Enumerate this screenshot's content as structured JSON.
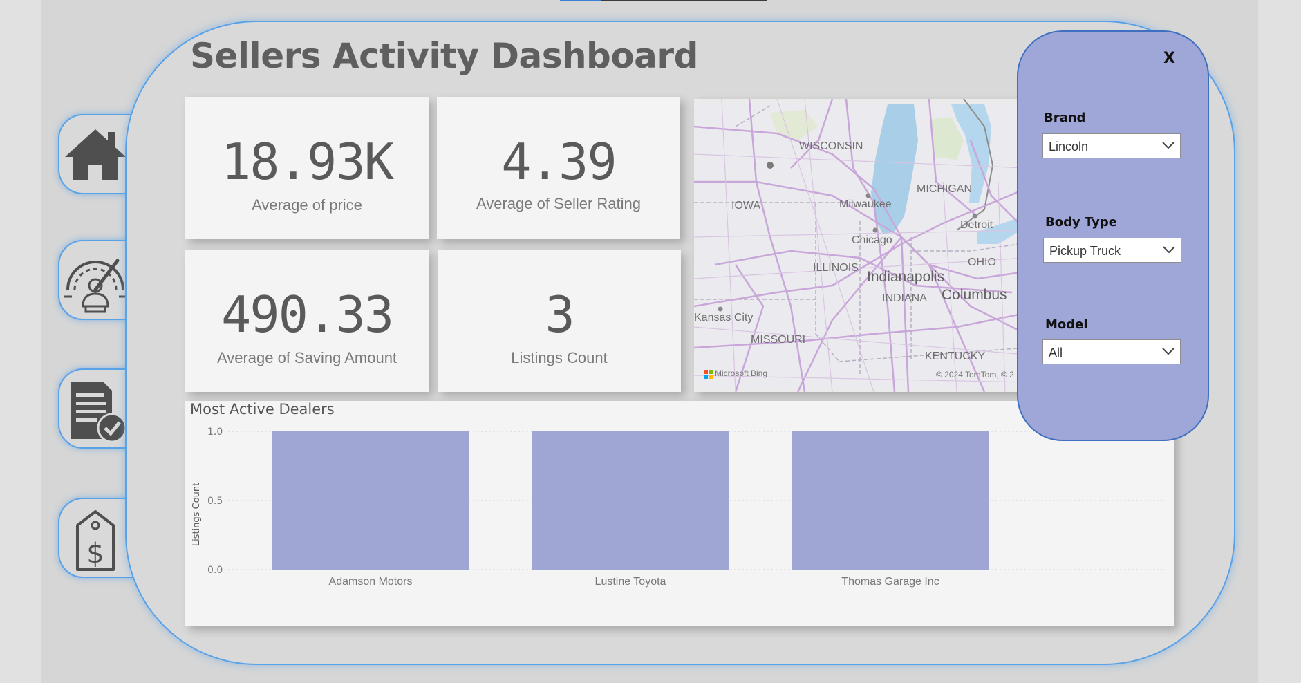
{
  "title": "Sellers Activity Dashboard",
  "colors": {
    "accent_blue": "#5aa2e8",
    "panel_fill": "#9fa6d8",
    "bar_fill": "#9fa6d3",
    "text_gray": "#5a5a5a"
  },
  "nav": [
    {
      "icon": "home-icon"
    },
    {
      "icon": "speedometer-icon"
    },
    {
      "icon": "document-check-icon"
    },
    {
      "icon": "price-tag-icon"
    }
  ],
  "kpis": [
    {
      "value": "18.93K",
      "label": "Average of price"
    },
    {
      "value": "4.39",
      "label": "Average of Seller Rating"
    },
    {
      "value": "490.33",
      "label": "Average of Saving Amount"
    },
    {
      "value": "3",
      "label": "Listings Count"
    }
  ],
  "map": {
    "labels": {
      "wisconsin": "WISCONSIN",
      "michigan": "MICHIGAN",
      "iowa": "IOWA",
      "milwaukee": "Milwaukee",
      "detroit": "Detroit",
      "chicago": "Chicago",
      "ohio": "OHIO",
      "illinois": "ILLINOIS",
      "indianapolis": "Indianapolis",
      "indiana": "INDIANA",
      "columbus": "Columbus",
      "kansas_city": "Kansas City",
      "missouri": "MISSOURI",
      "kentucky": "KENTUCKY"
    },
    "attribution_left": "Microsoft Bing",
    "attribution_right": "© 2024 TomTom, © 2"
  },
  "filters": {
    "close_label": "X",
    "brand": {
      "label": "Brand",
      "value": "Lincoln"
    },
    "body_type": {
      "label": "Body Type",
      "value": "Pickup Truck"
    },
    "model": {
      "label": "Model",
      "value": "All"
    }
  },
  "chart_data": {
    "type": "bar",
    "title": "Most Active Dealers",
    "ylabel": "Listings Count",
    "xlabel": "",
    "categories": [
      "Adamson Motors",
      "Lustine Toyota",
      "Thomas Garage Inc"
    ],
    "values": [
      1,
      1,
      1
    ],
    "ylim": [
      0,
      1
    ],
    "yticks": [
      "0.0",
      "0.5",
      "1.0"
    ],
    "grid": true
  }
}
